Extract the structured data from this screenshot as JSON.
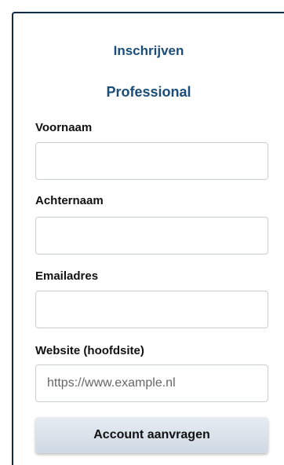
{
  "form": {
    "title": "Inschrijven",
    "subtitle": "Professional",
    "fields": [
      {
        "label": "Voornaam",
        "value": "",
        "placeholder": ""
      },
      {
        "label": "Achternaam",
        "value": "",
        "placeholder": ""
      },
      {
        "label": "Emailadres",
        "value": "",
        "placeholder": ""
      },
      {
        "label": "Website (hoofdsite)",
        "value": "",
        "placeholder": "https://www.example.nl"
      }
    ],
    "submit_label": "Account aanvragen"
  },
  "colors": {
    "heading": "#1a4d7a",
    "frame_border": "#0f2a45",
    "input_border": "#c9cfd6",
    "button_bg": "#d8e1ea"
  }
}
